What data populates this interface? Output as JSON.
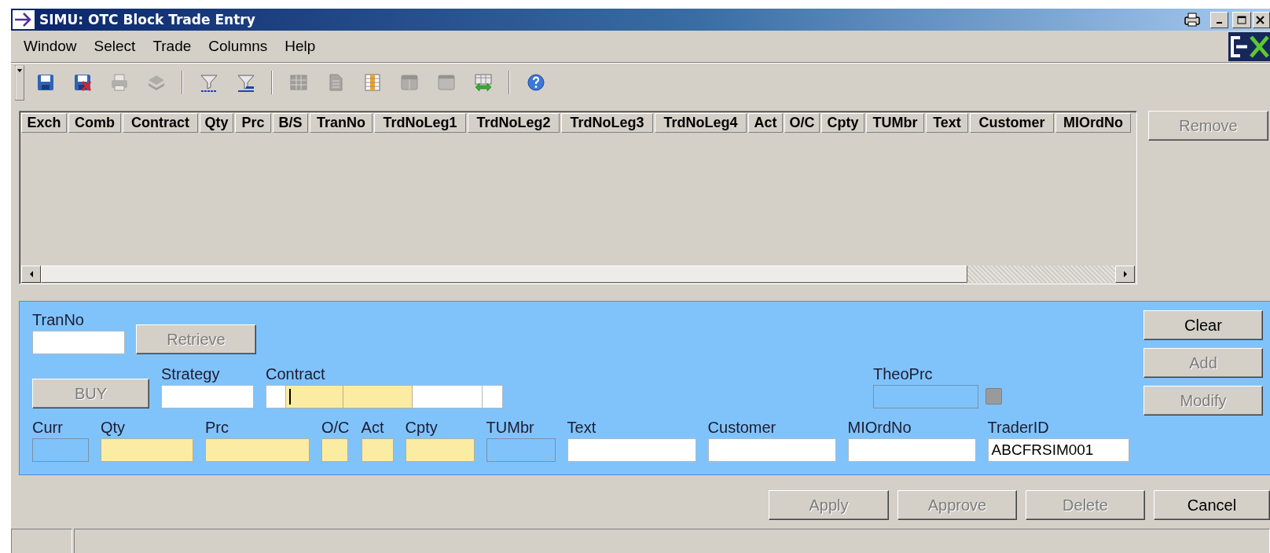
{
  "window": {
    "title": "SIMU: OTC Block Trade Entry"
  },
  "menu": [
    "Window",
    "Select",
    "Trade",
    "Columns",
    "Help"
  ],
  "toolbar": [
    {
      "kind": "button",
      "disabled": false
    },
    {
      "kind": "button",
      "disabled": false
    },
    {
      "kind": "button",
      "disabled": true
    },
    {
      "kind": "button",
      "disabled": true
    },
    {
      "kind": "separator"
    },
    {
      "kind": "button",
      "disabled": false
    },
    {
      "kind": "button",
      "disabled": false
    },
    {
      "kind": "separator"
    },
    {
      "kind": "button",
      "disabled": true
    },
    {
      "kind": "button",
      "disabled": true
    },
    {
      "kind": "button",
      "disabled": false
    },
    {
      "kind": "button",
      "disabled": true
    },
    {
      "kind": "button",
      "disabled": true
    },
    {
      "kind": "button",
      "disabled": false
    },
    {
      "kind": "separator"
    },
    {
      "kind": "button",
      "disabled": false
    }
  ],
  "table": {
    "columns": [
      "Exch",
      "Comb",
      "Contract",
      "Qty",
      "Prc",
      "B/S",
      "TranNo",
      "TrdNoLeg1",
      "TrdNoLeg2",
      "TrdNoLeg3",
      "TrdNoLeg4",
      "Act",
      "O/C",
      "Cpty",
      "TUMbr",
      "Text",
      "Customer",
      "MIOrdNo"
    ]
  },
  "remove_button": {
    "label": "Remove",
    "disabled": true
  },
  "entry_form": {
    "tran_no": {
      "label": "TranNo",
      "kind": "normal"
    },
    "retrieve_button": {
      "label": "Retrieve",
      "disabled": true
    },
    "side_button": {
      "label": "BUY",
      "disabled": true
    },
    "strategy": {
      "label": "Strategy",
      "kind": "normal"
    },
    "contract": {
      "label": "Contract",
      "segments": [
        {
          "kind": "normal",
          "focused": false
        },
        {
          "kind": "mandatory",
          "focused": true
        },
        {
          "kind": "mandatory",
          "focused": false
        },
        {
          "kind": "normal",
          "focused": false
        },
        {
          "kind": "normal",
          "focused": false
        }
      ]
    },
    "theo_prc": {
      "label": "TheoPrc",
      "kind": "readonly"
    },
    "fields": [
      {
        "label": "Curr",
        "kind": "readonly"
      },
      {
        "label": "Qty",
        "kind": "mandatory"
      },
      {
        "label": "Prc",
        "kind": "mandatory"
      },
      {
        "label": "O/C",
        "kind": "mandatory"
      },
      {
        "label": "Act",
        "kind": "mandatory"
      },
      {
        "label": "Cpty",
        "kind": "mandatory"
      },
      {
        "label": "TUMbr",
        "kind": "readonly"
      },
      {
        "label": "Text",
        "kind": "normal"
      },
      {
        "label": "Customer",
        "kind": "normal"
      },
      {
        "label": "MIOrdNo",
        "kind": "normal"
      },
      {
        "label": "TraderID",
        "kind": "normal",
        "value": "ABCFRSIM001"
      }
    ],
    "buttons": [
      {
        "label": "Clear",
        "disabled": false
      },
      {
        "label": "Add",
        "disabled": true
      },
      {
        "label": "Modify",
        "disabled": true
      }
    ]
  },
  "action_buttons": [
    {
      "label": "Apply",
      "disabled": true
    },
    {
      "label": "Approve",
      "disabled": true
    },
    {
      "label": "Delete",
      "disabled": true
    },
    {
      "label": "Cancel",
      "disabled": false
    }
  ]
}
